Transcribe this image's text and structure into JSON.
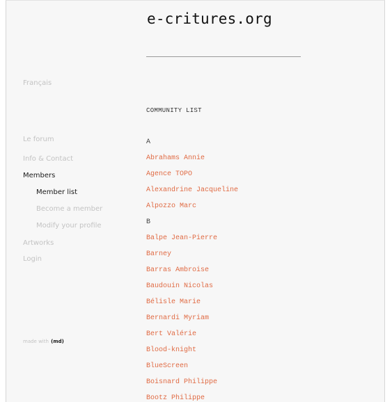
{
  "site": {
    "title": "e-critures.org"
  },
  "sidebar": {
    "language_link": "Français",
    "items": [
      {
        "label": "Le forum"
      },
      {
        "label": "Info & Contact"
      },
      {
        "label": "Members"
      },
      {
        "label": "Member list"
      },
      {
        "label": "Become a member"
      },
      {
        "label": "Modify your profile"
      },
      {
        "label": "Artworks"
      },
      {
        "label": "Login"
      }
    ],
    "footer_note_faint": "made with",
    "footer_note_bold": "(md)"
  },
  "main": {
    "heading": "COMMUNITY LIST",
    "entries": [
      {
        "type": "letter",
        "text": "A"
      },
      {
        "type": "member",
        "text": "Abrahams Annie"
      },
      {
        "type": "member",
        "text": "Agence TOPO"
      },
      {
        "type": "member",
        "text": "Alexandrine Jacqueline"
      },
      {
        "type": "member",
        "text": "Alpozzo Marc"
      },
      {
        "type": "letter",
        "text": "B"
      },
      {
        "type": "member",
        "text": "Balpe Jean-Pierre"
      },
      {
        "type": "member",
        "text": "Barney"
      },
      {
        "type": "member",
        "text": "Barras Ambroise"
      },
      {
        "type": "member",
        "text": "Baudouin Nicolas"
      },
      {
        "type": "member",
        "text": "Bélisle Marie"
      },
      {
        "type": "member",
        "text": "Bernardi Myriam"
      },
      {
        "type": "member",
        "text": "Bert Valérie"
      },
      {
        "type": "member",
        "text": "Blood-knight"
      },
      {
        "type": "member",
        "text": "BlueScreen"
      },
      {
        "type": "member",
        "text": "Boisnard Philippe"
      },
      {
        "type": "member",
        "text": "Bootz Philippe"
      }
    ]
  },
  "colors": {
    "link": "#e06a43",
    "faint": "#c3c3c3",
    "text": "#1a1a1a",
    "background": "#f7f7f7"
  }
}
